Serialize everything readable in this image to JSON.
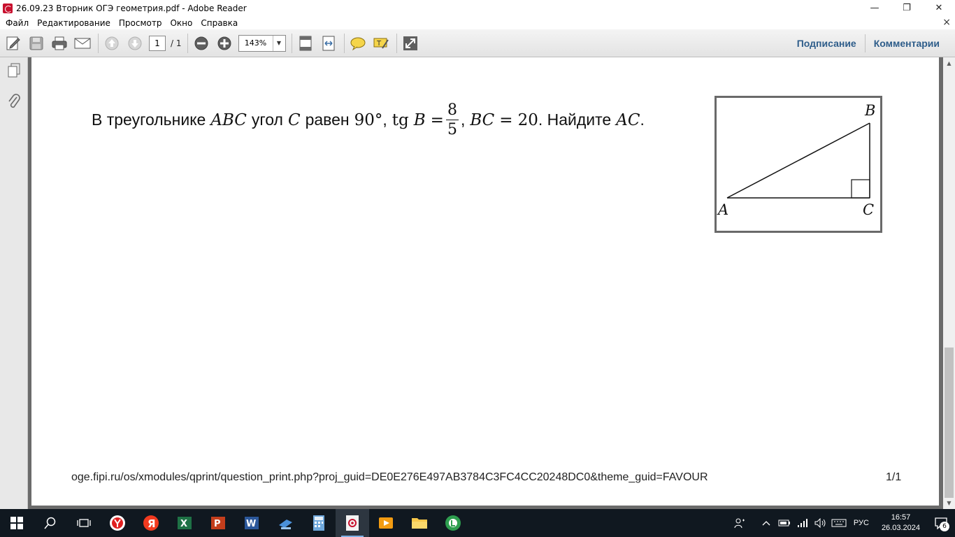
{
  "window": {
    "title": "26.09.23 Вторник ОГЭ геометрия.pdf - Adobe Reader",
    "minimize": "—",
    "restore": "❐",
    "close": "✕"
  },
  "menu": {
    "items": [
      "Файл",
      "Редактирование",
      "Просмотр",
      "Окно",
      "Справка"
    ],
    "close_symbol": "×"
  },
  "toolbar": {
    "page_current": "1",
    "page_total": "/ 1",
    "zoom": "143%",
    "sign_label": "Подписание",
    "comments_label": "Комментарии"
  },
  "document": {
    "problem": {
      "t1": "В треугольнике",
      "m_abc": "ABC",
      "t2": "угол",
      "m_c": "C",
      "t3": "равен",
      "m_deg": "90°",
      "t4": ",",
      "m_tg": "tg",
      "m_b": "B",
      "m_eq1": "=",
      "frac_num": "8",
      "frac_den": "5",
      "t5": ",",
      "m_bc": "BC",
      "m_eq2": "=",
      "m_20": "20",
      "t6": ". Найдите",
      "m_ac": "AC",
      "t7": "."
    },
    "figure": {
      "label_a": "A",
      "label_b": "B",
      "label_c": "C"
    },
    "footer_url": "oge.fipi.ru/os/xmodules/qprint/question_print.php?proj_guid=DE0E276E497AB3784C3FC4CC20248DC0&theme_guid=FAVOUR",
    "footer_page": "1/1"
  },
  "taskbar": {
    "lang": "РУС",
    "time": "16:57",
    "date": "26.03.2024",
    "notifications": "6"
  }
}
